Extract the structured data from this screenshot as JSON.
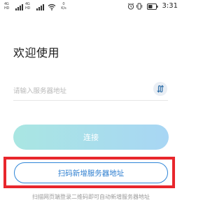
{
  "status_bar": {
    "sim1_label_top": "4G",
    "sim1_label_bottom": "HD",
    "sim2_label_top": "4G",
    "sim2_label_bottom": "HD",
    "net_speed_value": "0",
    "net_speed_unit": "K/s",
    "battery_level": 0.55,
    "time": "3:31"
  },
  "login": {
    "title": "欢迎使用",
    "server_input": {
      "value": "",
      "placeholder": "请输入服务器地址"
    },
    "switch_icon": "swap-arrows-icon",
    "connect_button": "连接",
    "scan_button": "扫码新增服务器地址",
    "hint": "扫描网页端登录二维码即可自动新增服务器地址"
  },
  "colors": {
    "accent_blue": "#2f86d8",
    "connect_gradient_start": "#a9e6e2",
    "connect_gradient_end": "#a8d6f4",
    "highlight_red": "#e8262c"
  }
}
